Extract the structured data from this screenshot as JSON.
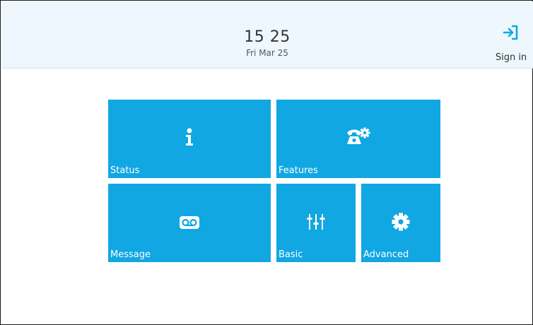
{
  "header": {
    "time": "15 25",
    "date": "Fri Mar 25",
    "sign_in_label": "Sign in",
    "sign_in_icon": "sign-in-icon"
  },
  "tiles": [
    {
      "label": "Status",
      "icon": "info-icon"
    },
    {
      "label": "Features",
      "icon": "phone-settings-icon"
    },
    {
      "label": "Message",
      "icon": "voicemail-icon"
    },
    {
      "label": "Basic",
      "icon": "sliders-icon"
    },
    {
      "label": "Advanced",
      "icon": "gear-icon"
    }
  ],
  "colors": {
    "tile_background": "#11a7e2",
    "topbar_background": "#eef7fd",
    "accent": "#11a7e2"
  }
}
